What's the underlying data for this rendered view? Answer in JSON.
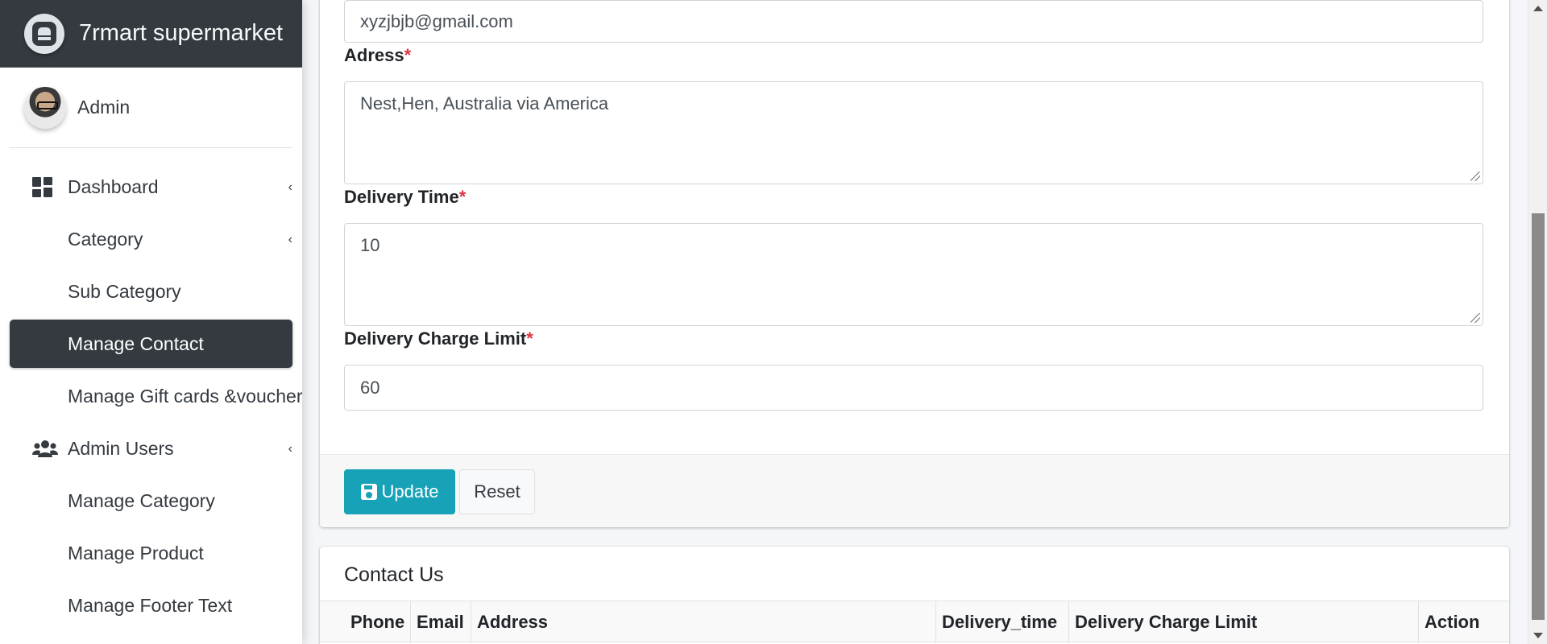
{
  "brand": {
    "name": "7rmart supermarket"
  },
  "user": {
    "name": "Admin"
  },
  "sidebar": {
    "items": [
      {
        "label": "Dashboard",
        "icon": "dashboard-grid-icon",
        "caret": "‹"
      },
      {
        "label": "Category",
        "caret": "‹"
      },
      {
        "label": "Sub Category"
      },
      {
        "label": "Manage Contact",
        "active": true
      },
      {
        "label": "Manage Gift cards &voucher"
      },
      {
        "label": "Admin Users",
        "icon": "users-icon",
        "caret": "‹"
      },
      {
        "label": "Manage Category"
      },
      {
        "label": "Manage Product"
      },
      {
        "label": "Manage Footer Text"
      }
    ]
  },
  "form": {
    "email_value": "xyzjbjb@gmail.com",
    "address_label": "Adress",
    "address_value": "Nest,Hen, Australia via America",
    "delivery_time_label": "Delivery Time",
    "delivery_time_value": "10",
    "delivery_charge_label": "Delivery Charge Limit",
    "delivery_charge_value": "60",
    "required_mark": "*",
    "update_label": "Update",
    "reset_label": "Reset"
  },
  "contact_table": {
    "title": "Contact Us",
    "columns": [
      "Phone",
      "Email",
      "Address",
      "Delivery_time",
      "Delivery Charge Limit",
      "Action"
    ]
  },
  "colors": {
    "sidebar_dark": "#343a40",
    "update_button": "#17a2b8",
    "required": "#dc3545"
  }
}
